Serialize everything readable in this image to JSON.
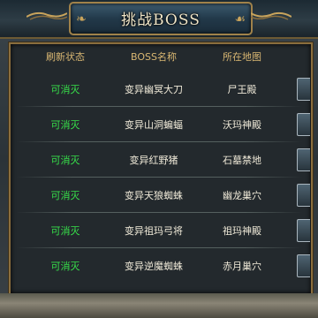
{
  "window": {
    "title": "挑战BOSS"
  },
  "table": {
    "headers": [
      "刷新状态",
      "BOSS名称",
      "所在地图"
    ],
    "rows": [
      {
        "status": "可消灭",
        "name": "变异幽冥大刀",
        "map": "尸王殿"
      },
      {
        "status": "可消灭",
        "name": "变异山洞蝙蝠",
        "map": "沃玛神殿"
      },
      {
        "status": "可消灭",
        "name": "变异红野猪",
        "map": "石墓禁地"
      },
      {
        "status": "可消灭",
        "name": "变异天狼蜘蛛",
        "map": "幽龙巢穴"
      },
      {
        "status": "可消灭",
        "name": "变异祖玛弓将",
        "map": "祖玛神殿"
      },
      {
        "status": "可消灭",
        "name": "变异逆魔蜘蛛",
        "map": "赤月巢穴"
      }
    ]
  },
  "colors": {
    "status": "#37e04a",
    "header": "#d9b772",
    "text": "#efe9d8",
    "frame": "#8a6e3e"
  }
}
